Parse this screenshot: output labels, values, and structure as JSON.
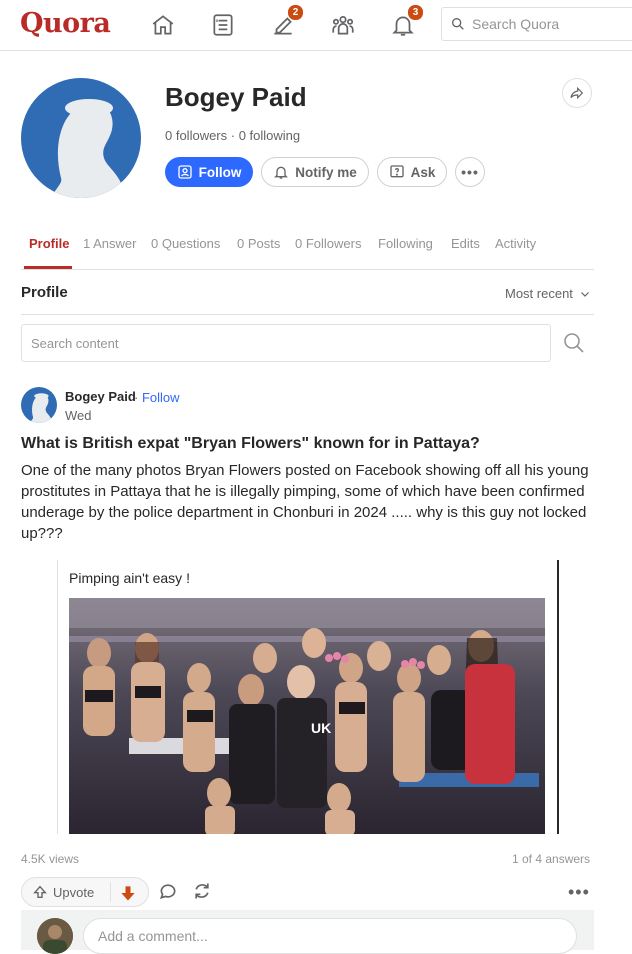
{
  "header": {
    "logo": "Quora",
    "search_placeholder": "Search Quora",
    "notifications": {
      "write_badge": "2",
      "bell_badge": "3"
    }
  },
  "profile": {
    "name": "Bogey Paid",
    "followers_line": "0 followers · 0 following",
    "buttons": {
      "follow": "Follow",
      "notify": "Notify me",
      "ask": "Ask"
    }
  },
  "tabs": [
    "Profile",
    "1 Answer",
    "0 Questions",
    "0 Posts",
    "0 Followers",
    "Following",
    "Edits",
    "Activity"
  ],
  "section": {
    "title": "Profile",
    "sort": "Most recent"
  },
  "content_search": {
    "placeholder": "Search content"
  },
  "answer": {
    "author": "Bogey Paid",
    "separator": "·",
    "follow": "Follow",
    "date": "Wed",
    "question": "What is British expat \"Bryan Flowers\" known for in Pattaya?",
    "body": "One of the many photos Bryan Flowers posted on Facebook showing off all his young prostitutes in Pattaya that he is illegally pimping, some of which have been confirmed underage by the police department in Chonburi in 2024 ..... why is this guy not locked up???",
    "embed_caption": "Pimping ain't easy !",
    "shirt_text": "UK",
    "views": "4.5K views",
    "answer_count": "1 of 4 answers",
    "upvote": "Upvote",
    "comment_placeholder": "Add a comment..."
  },
  "colors": {
    "brand": "#b92b27",
    "follow_blue": "#2e69ff",
    "badge": "#cb4b10",
    "downvote": "#cb4b10"
  },
  "icons": [
    "home-icon",
    "answer-icon",
    "write-icon",
    "spaces-icon",
    "bell-icon",
    "search-icon",
    "share-icon",
    "follow-icon",
    "bell-outline-icon",
    "ask-icon",
    "more-icon",
    "chevron-down-icon",
    "upvote-icon",
    "downvote-icon",
    "comment-icon",
    "reshare-icon"
  ]
}
